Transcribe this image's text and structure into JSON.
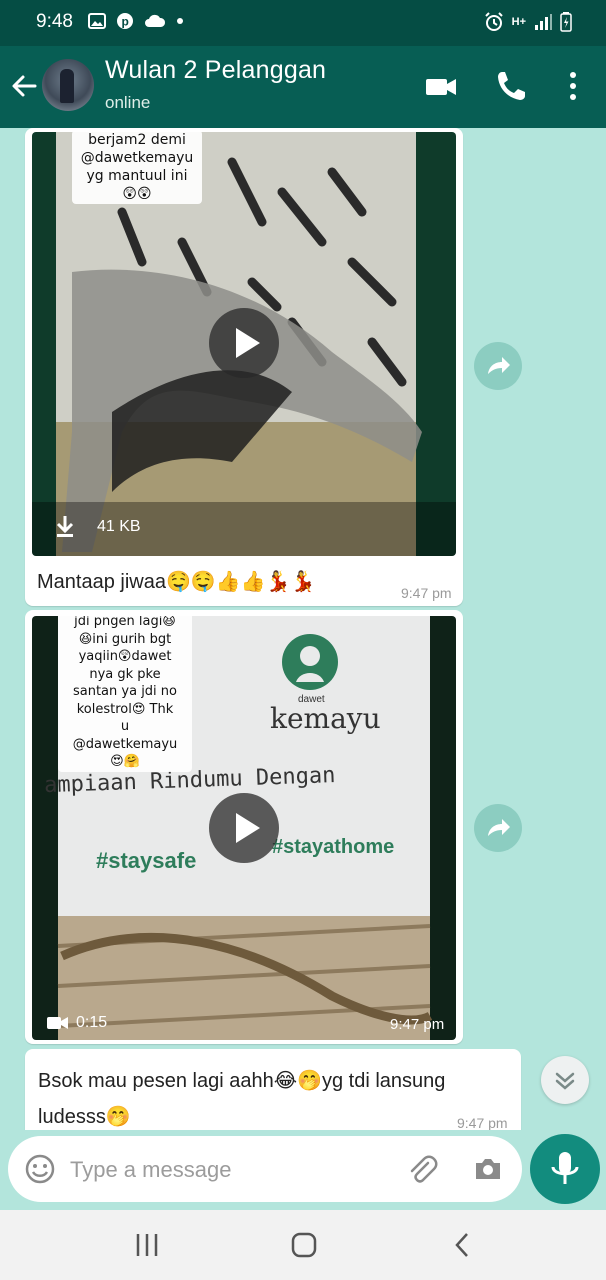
{
  "status_bar": {
    "time": "9:48",
    "network": "H+",
    "icons_left": [
      "image-icon",
      "pinterest-icon",
      "cloud-icon",
      "dot-icon"
    ],
    "icons_right": [
      "alarm-icon",
      "network-icon",
      "signal-icon",
      "battery-icon"
    ]
  },
  "header": {
    "contact_name": "Wulan 2 Pelanggan",
    "status": "online",
    "actions": [
      "video-call-icon",
      "voice-call-icon",
      "more-options-icon"
    ]
  },
  "messages": [
    {
      "type": "video",
      "overlay_text": [
        "berjam2 demi",
        "@dawetkemayu",
        "yg mantuul ini",
        "😲😲"
      ],
      "download_size": "41 KB",
      "caption": "Mantaap jiwaa🤤🤤👍👍💃💃",
      "time": "9:47 pm"
    },
    {
      "type": "video",
      "overlay_text": [
        "jdi pngen lagi😆",
        "😆ini gurih bgt",
        "yaqiin😲dawet",
        "nya gk pke",
        "santan ya jdi no",
        "kolestrol😍 Thk",
        "u",
        "@dawetkemayu",
        "😍🤗"
      ],
      "poster": {
        "brand_small": "dawet",
        "brand": "kemayu",
        "handwriting": "ampiaan Rindumu Dengan",
        "tag1": "#staysafe",
        "tag2": "#stayathome"
      },
      "duration": "0:15",
      "time": "9:47 pm"
    },
    {
      "type": "text",
      "line1": "Bsok mau pesen lagi aahh😂🤭yg tdi lansung",
      "line2": "ludesss🤭",
      "time": "9:47 pm"
    }
  ],
  "input": {
    "placeholder": "Type a message"
  },
  "colors": {
    "header": "#075e54",
    "status_bar": "#054d44",
    "chat_background": "#b3e5dc",
    "mic_button": "#128c7e"
  }
}
